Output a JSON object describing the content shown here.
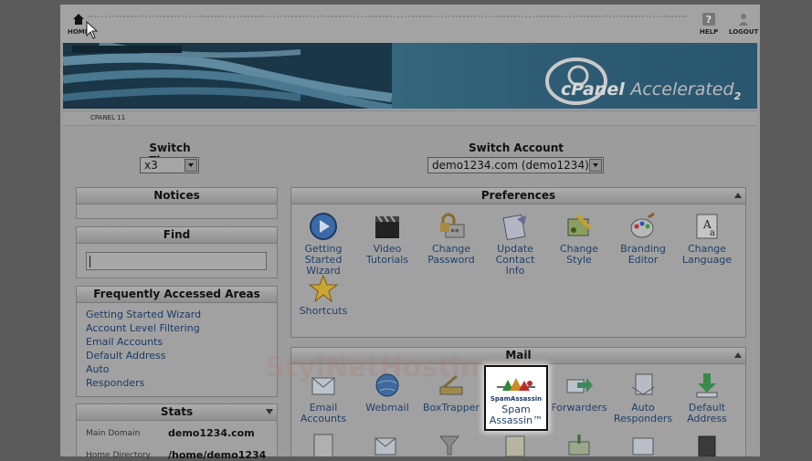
{
  "topbar": {
    "home": "HOME",
    "help": "HELP",
    "logout": "LOGOUT"
  },
  "banner": {
    "cp": "cPanel",
    "accelerated": "Accelerated",
    "version": "2"
  },
  "subbar": {
    "label": "CPANEL 11"
  },
  "switch_theme": {
    "label": "Switch Theme",
    "value": "x3"
  },
  "switch_account": {
    "label": "Switch Account",
    "value": "demo1234.com (demo1234)"
  },
  "notices": {
    "title": "Notices"
  },
  "find": {
    "title": "Find",
    "value": ""
  },
  "frequent": {
    "title": "Frequently Accessed Areas",
    "links": [
      "Getting Started Wizard",
      "Account Level Filtering",
      "Email Accounts",
      "Default Address",
      "Auto",
      "Responders"
    ]
  },
  "stats": {
    "title": "Stats",
    "rows": [
      {
        "label": "Main Domain",
        "value": "demo1234.com"
      },
      {
        "label": "Home Directory",
        "value": "/home/demo1234"
      }
    ]
  },
  "preferences": {
    "title": "Preferences",
    "items": [
      {
        "lines": [
          "Getting",
          "Started",
          "Wizard"
        ],
        "icon": "play-icon"
      },
      {
        "lines": [
          "Video",
          "Tutorials"
        ],
        "icon": "clapperboard-icon"
      },
      {
        "lines": [
          "Change",
          "Password"
        ],
        "icon": "lock-icon"
      },
      {
        "lines": [
          "Update",
          "Contact",
          "Info"
        ],
        "icon": "contact-card-icon"
      },
      {
        "lines": [
          "Change",
          "Style"
        ],
        "icon": "palette-icon"
      },
      {
        "lines": [
          "Branding",
          "Editor"
        ],
        "icon": "branding-icon"
      },
      {
        "lines": [
          "Change",
          "Language"
        ],
        "icon": "language-icon"
      },
      {
        "lines": [
          "Shortcuts"
        ],
        "icon": "star-icon"
      }
    ]
  },
  "mail": {
    "title": "Mail",
    "items": [
      {
        "lines": [
          "Email",
          "Accounts"
        ],
        "icon": "envelope-icon"
      },
      {
        "lines": [
          "Webmail"
        ],
        "icon": "globe-icon"
      },
      {
        "lines": [
          "BoxTrapper"
        ],
        "icon": "trap-icon"
      },
      {
        "lines": [
          "Spam",
          "Assassin™"
        ],
        "icon": "spamassassin-icon",
        "logo_text": "SpamAssassin"
      },
      {
        "lines": [
          "Forwarders"
        ],
        "icon": "forward-arrow-icon"
      },
      {
        "lines": [
          "Auto",
          "Responders"
        ],
        "icon": "auto-responder-icon"
      },
      {
        "lines": [
          "Default",
          "Address"
        ],
        "icon": "download-arrow-icon"
      }
    ]
  },
  "watermark": {
    "text": "StylNetHosting",
    "suffix": "net"
  },
  "colors": {
    "link": "#1a3b66",
    "dim_overlay": "#5b5b5b"
  }
}
